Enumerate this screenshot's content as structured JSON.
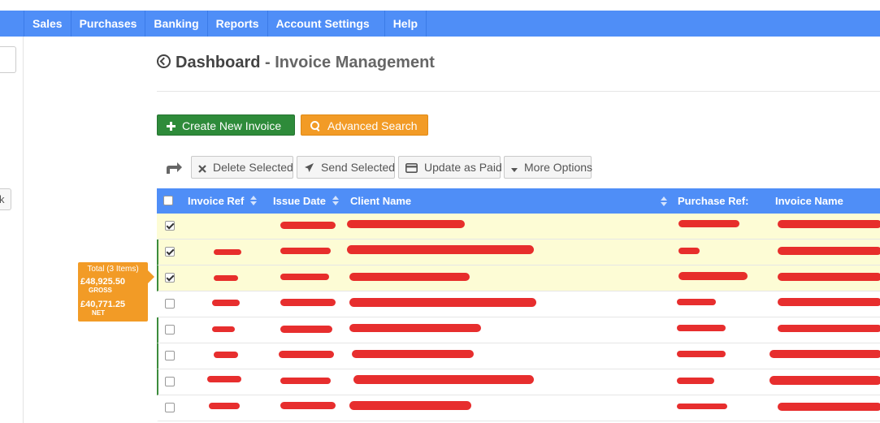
{
  "nav": {
    "items": [
      {
        "label": "Sales"
      },
      {
        "label": "Purchases"
      },
      {
        "label": "Banking"
      },
      {
        "label": "Reports"
      },
      {
        "label": "Account Settings"
      },
      {
        "label": "Help"
      }
    ]
  },
  "left_panel": {
    "button_text": "k"
  },
  "page": {
    "title": "Dashboard",
    "separator": " - ",
    "subtitle": "Invoice Management"
  },
  "actions": {
    "create_label": "Create New Invoice",
    "advanced_search_label": "Advanced Search"
  },
  "toolbar": {
    "delete_label": "Delete Selected",
    "send_label": "Send Selected",
    "update_label": "Update as Paid",
    "more_label": "More Options"
  },
  "table": {
    "columns": [
      "Invoice Ref",
      "Issue Date",
      "Client Name",
      "Purchase Ref:",
      "Invoice Name"
    ],
    "rows": [
      {
        "checked": true,
        "selected": true,
        "marked": false
      },
      {
        "checked": true,
        "selected": true,
        "marked": true
      },
      {
        "checked": true,
        "selected": true,
        "marked": true
      },
      {
        "checked": false,
        "selected": false,
        "marked": false
      },
      {
        "checked": false,
        "selected": false,
        "marked": true
      },
      {
        "checked": false,
        "selected": false,
        "marked": true
      },
      {
        "checked": false,
        "selected": false,
        "marked": true
      },
      {
        "checked": false,
        "selected": false,
        "marked": false
      }
    ]
  },
  "totals": {
    "title": "Total (3 Items)",
    "gross_value": "£48,925.50",
    "gross_label": "GROSS",
    "net_value": "£40,771.25",
    "net_label": "NET"
  },
  "colors": {
    "nav_bg": "#4f8ef7",
    "create_button": "#2e8b3a",
    "advanced_button": "#f29b26",
    "selected_row": "#fdfcd5",
    "redaction": "#e51c1c"
  }
}
